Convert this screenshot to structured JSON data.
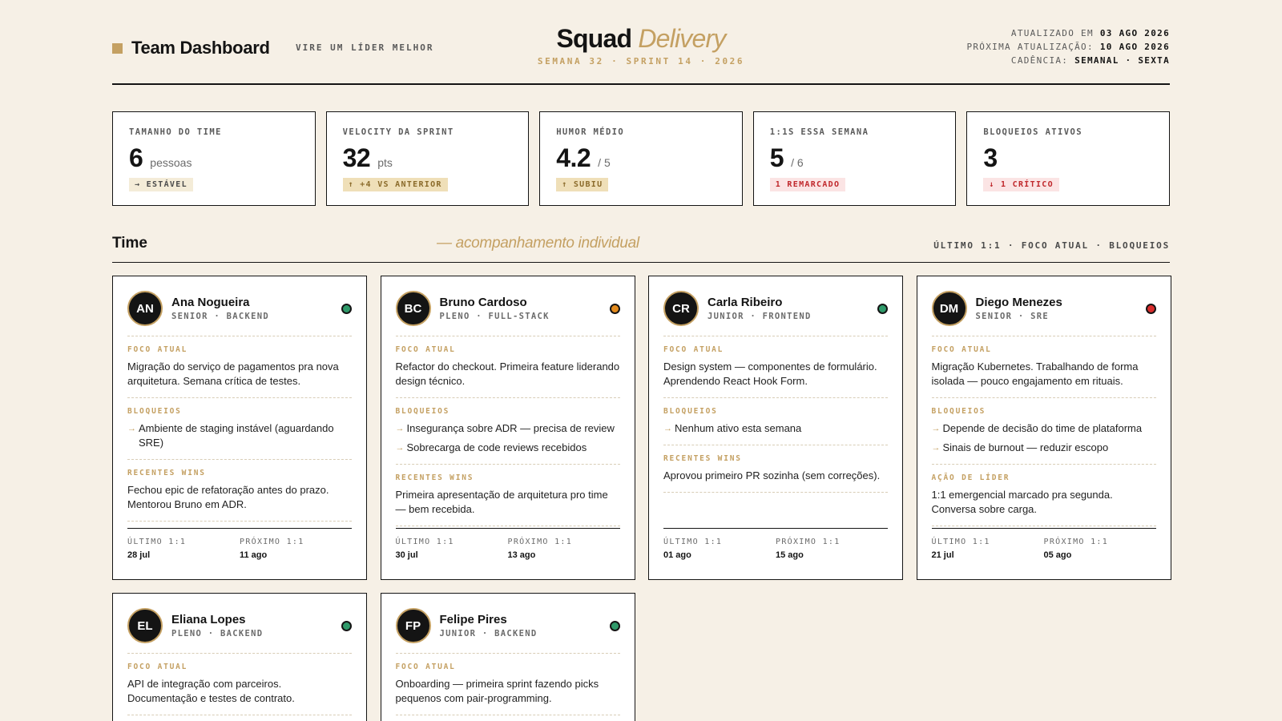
{
  "header": {
    "brand_title": "Team Dashboard",
    "tagline": "VIRE UM LÍDER MELHOR",
    "squad_strong": "Squad",
    "squad_accent": "Delivery",
    "squad_sub": "SEMANA 32 · SPRINT 14 · 2026",
    "meta": [
      {
        "label": "ATUALIZADO EM",
        "value": "03 AGO 2026"
      },
      {
        "label": "PRÓXIMA ATUALIZAÇÃO:",
        "value": "10 AGO 2026"
      },
      {
        "label": "CADÊNCIA:",
        "value": "SEMANAL · SEXTA"
      }
    ]
  },
  "colors": {
    "accent": "#c4a062",
    "background": "#f6f0e6",
    "status_green": "#2f9a6a",
    "status_orange": "#e48b1d",
    "status_red": "#d92c2c"
  },
  "kpis": [
    {
      "label": "TAMANHO DO TIME",
      "value": "6",
      "unit": "pessoas",
      "badge": "→ ESTÁVEL",
      "tone": "neutral"
    },
    {
      "label": "VELOCITY DA SPRINT",
      "value": "32",
      "unit": "pts",
      "badge": "↑ +4 VS ANTERIOR",
      "tone": "gold"
    },
    {
      "label": "HUMOR MÉDIO",
      "value": "4.2",
      "unit": "/ 5",
      "badge": "↑ SUBIU",
      "tone": "gold"
    },
    {
      "label": "1:1S ESSA SEMANA",
      "value": "5",
      "unit": "/ 6",
      "badge": "1 REMARCADO",
      "tone": "red"
    },
    {
      "label": "BLOQUEIOS ATIVOS",
      "value": "3",
      "unit": "",
      "badge": "↓ 1 CRÍTICO",
      "tone": "red"
    }
  ],
  "section": {
    "title": "Time",
    "subtitle": "— acompanhamento individual",
    "right": "ÚLTIMO 1:1 · FOCO ATUAL · BLOQUEIOS"
  },
  "members": [
    {
      "initials": "AN",
      "name": "Ana Nogueira",
      "role": "SENIOR · BACKEND",
      "status": "green",
      "focus_label": "FOCO ATUAL",
      "focus": "Migração do serviço de pagamentos pra nova arquitetura. Semana crítica de testes.",
      "blocks_label": "BLOQUEIOS",
      "blocks": [
        "Ambiente de staging instável (aguardando SRE)"
      ],
      "extra_label": "RECENTES WINS",
      "extra": "Fechou epic de refatoração antes do prazo. Mentorou Bruno em ADR.",
      "last_label": "ÚLTIMO 1:1",
      "last": "28 jul",
      "next_label": "PRÓXIMO 1:1",
      "next": "11 ago"
    },
    {
      "initials": "BC",
      "name": "Bruno Cardoso",
      "role": "PLENO · FULL-STACK",
      "status": "orange",
      "focus_label": "FOCO ATUAL",
      "focus": "Refactor do checkout. Primeira feature liderando design técnico.",
      "blocks_label": "BLOQUEIOS",
      "blocks": [
        "Insegurança sobre ADR — precisa de review",
        "Sobrecarga de code reviews recebidos"
      ],
      "extra_label": "RECENTES WINS",
      "extra": "Primeira apresentação de arquitetura pro time — bem recebida.",
      "last_label": "ÚLTIMO 1:1",
      "last": "30 jul",
      "next_label": "PRÓXIMO 1:1",
      "next": "13 ago"
    },
    {
      "initials": "CR",
      "name": "Carla Ribeiro",
      "role": "JUNIOR · FRONTEND",
      "status": "green",
      "focus_label": "FOCO ATUAL",
      "focus": "Design system — componentes de formulário. Aprendendo React Hook Form.",
      "blocks_label": "BLOQUEIOS",
      "blocks": [
        "Nenhum ativo esta semana"
      ],
      "extra_label": "RECENTES WINS",
      "extra": "Aprovou primeiro PR sozinha (sem correções).",
      "last_label": "ÚLTIMO 1:1",
      "last": "01 ago",
      "next_label": "PRÓXIMO 1:1",
      "next": "15 ago"
    },
    {
      "initials": "DM",
      "name": "Diego Menezes",
      "role": "SENIOR · SRE",
      "status": "red",
      "focus_label": "FOCO ATUAL",
      "focus": "Migração Kubernetes. Trabalhando de forma isolada — pouco engajamento em rituais.",
      "blocks_label": "BLOQUEIOS",
      "blocks": [
        "Depende de decisão do time de plataforma",
        "Sinais de burnout — reduzir escopo"
      ],
      "extra_label": "AÇÃO DE LÍDER",
      "extra": "1:1 emergencial marcado pra segunda. Conversa sobre carga.",
      "last_label": "ÚLTIMO 1:1",
      "last": "21 jul",
      "next_label": "PRÓXIMO 1:1",
      "next": "05 ago"
    },
    {
      "initials": "EL",
      "name": "Eliana Lopes",
      "role": "PLENO · BACKEND",
      "status": "green",
      "focus_label": "FOCO ATUAL",
      "focus": "API de integração com parceiros. Documentação e testes de contrato."
    },
    {
      "initials": "FP",
      "name": "Felipe Pires",
      "role": "JUNIOR · BACKEND",
      "status": "green",
      "focus_label": "FOCO ATUAL",
      "focus": "Onboarding — primeira sprint fazendo picks pequenos com pair-programming."
    }
  ]
}
